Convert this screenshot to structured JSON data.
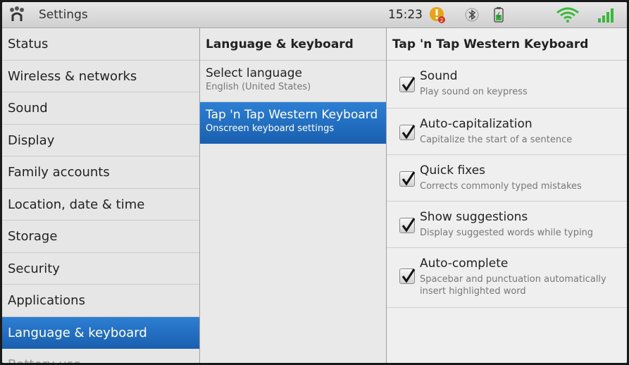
{
  "statusbar": {
    "app_title": "Settings",
    "time": "15:23",
    "icons": [
      "app-icon",
      "warning-icon",
      "bluetooth-icon",
      "battery-icon",
      "wifi-icon",
      "signal-icon"
    ]
  },
  "sidebar": {
    "items": [
      {
        "label": "Status"
      },
      {
        "label": "Wireless & networks"
      },
      {
        "label": "Sound"
      },
      {
        "label": "Display"
      },
      {
        "label": "Family accounts"
      },
      {
        "label": "Location, date & time"
      },
      {
        "label": "Storage"
      },
      {
        "label": "Security"
      },
      {
        "label": "Applications"
      },
      {
        "label": "Language & keyboard",
        "selected": true
      },
      {
        "label": "Battery use"
      }
    ]
  },
  "middle": {
    "header": "Language & keyboard",
    "items": [
      {
        "title": "Select language",
        "subtitle": "English (United States)"
      },
      {
        "title": "Tap 'n Tap Western Keyboard",
        "subtitle": "Onscreen keyboard settings",
        "selected": true
      }
    ]
  },
  "right": {
    "header": "Tap 'n Tap Western Keyboard",
    "options": [
      {
        "title": "Sound",
        "subtitle": "Play sound on keypress",
        "checked": true
      },
      {
        "title": "Auto-capitalization",
        "subtitle": "Capitalize the start of a sentence",
        "checked": true
      },
      {
        "title": "Quick fixes",
        "subtitle": "Corrects commonly typed mistakes",
        "checked": true
      },
      {
        "title": "Show suggestions",
        "subtitle": "Display suggested words while typing",
        "checked": true
      },
      {
        "title": "Auto-complete",
        "subtitle": "Spacebar and punctuation automatically insert highlighted word",
        "checked": true
      }
    ]
  },
  "colors": {
    "selection": "#1f6bbf",
    "wifi": "#3bb83b",
    "signal": "#3bb83b",
    "warning": "#e8a317"
  }
}
